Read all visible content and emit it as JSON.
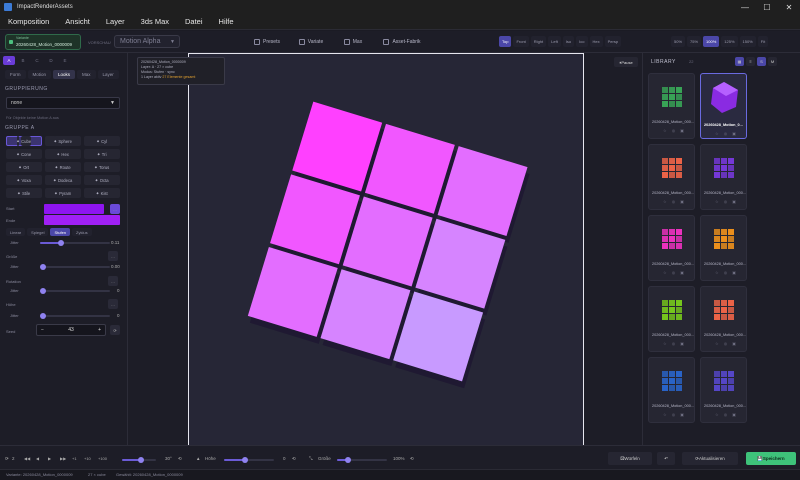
{
  "window": {
    "title": "ImpactRenderAssets",
    "min": "—",
    "max": "☐",
    "close": "✕"
  },
  "menu": [
    "Komposition",
    "Ansicht",
    "Layer",
    "3ds Max",
    "Datei",
    "Hilfe"
  ],
  "toolbar": {
    "variant_caption": "Variante",
    "variant_name": "20260428_Motion_0000009",
    "vorschau_label": "VORSCHAU",
    "preset_dropdown": "Motion Alpha",
    "center_buttons": [
      "Presets",
      "Variate",
      "Max",
      "Asset-Fabrik"
    ],
    "view_buttons": [
      "Top",
      "Front",
      "Right",
      "Left",
      "Iso",
      "Ico",
      "Hex",
      "Persp"
    ],
    "active_view": "Top",
    "zoom_buttons": [
      "50%",
      "75%",
      "100%",
      "125%",
      "150%",
      "Fit"
    ],
    "active_zoom": "100%"
  },
  "sidebar": {
    "layer_tabs": [
      "A",
      "B",
      "C",
      "D",
      "E"
    ],
    "active_layer": "A",
    "tabs": [
      "Form",
      "Motion",
      "Looks",
      "Max",
      "Layer"
    ],
    "active_tab": "Looks",
    "gruppierung_label": "GRUPPIERUNG",
    "gruppierung_value": "none",
    "hint": "Für Objekte keine Motion A aus",
    "gruppe_label": "GRUPPE A",
    "shapes": [
      "Cube",
      "Sphere",
      "Cyl",
      "Cone",
      "Hex",
      "Tri",
      "Ort",
      "Route",
      "Torus",
      "Voxa",
      "Dodeca",
      "Octa",
      "Stile",
      "Pyram",
      "Kist"
    ],
    "active_shape": "Cube",
    "start_label": "Start",
    "ende_label": "Ende",
    "color_start": "#8e15f0",
    "color_ende": "#a020f5",
    "mode_tabs": [
      "Linear",
      "Spiegel",
      "Stufen",
      "Zyklus"
    ],
    "active_mode": "Stufen",
    "rows": [
      {
        "label": "Jitter",
        "value": "0.11",
        "fraction": 0.3
      },
      {
        "label": "Größe",
        "sub": "Jitter",
        "value": "0.00",
        "fraction": 0.0
      },
      {
        "label": "Rotation",
        "sub": "Jitter",
        "value": "0",
        "fraction": 0.0
      },
      {
        "label": "Höhe",
        "sub": "Jitter",
        "value": "0",
        "fraction": 0.0
      }
    ],
    "seed_label": "Seed",
    "seed_value": "43",
    "seed_minus": "−",
    "seed_plus": "+"
  },
  "viewport": {
    "info_line1": "20260428_Motion_0000009",
    "info_line2": "Layer: A  ·  27 × cube",
    "info_line3": "Modus: Stufen  ·  sync",
    "info_line4a": "1 Layer aktiv",
    "info_line4b": "27 Elemente gesamt",
    "pause_label": "Pause",
    "cube_color_top": "#ff4fff",
    "cube_color_bottom": "#c080ff"
  },
  "library": {
    "title": "LIBRARY",
    "count": "22",
    "tiles": [
      {
        "name": "20260428_Motion_000...",
        "color": "#3ab05a"
      },
      {
        "name": "20260428_Motion_0...",
        "color": "#8a2be2",
        "selected": true
      },
      {
        "name": "20260428_Motion_000...",
        "color": "#ff6a4a"
      },
      {
        "name": "20260428_Motion_000...",
        "color": "#7d3ae8"
      },
      {
        "name": "20260428_Motion_000...",
        "color": "#ff33cc"
      },
      {
        "name": "20260428_Motion_000...",
        "color": "#ff9a1a"
      },
      {
        "name": "20260428_Motion_000...",
        "color": "#7dd61a"
      },
      {
        "name": "20260428_Motion_000...",
        "color": "#ff6a4a"
      },
      {
        "name": "20260428_Motion_000...",
        "color": "#2a6ad6"
      },
      {
        "name": "20260428_Motion_000...",
        "color": "#5a4ad6"
      }
    ]
  },
  "bottombar": {
    "frame": "2",
    "nav": [
      "◀◀",
      "◀",
      "▶",
      "▶▶",
      "+1",
      "+10",
      "+100"
    ],
    "rot_label": "Rotation",
    "rot_value": "30°",
    "hoehe_label": "Höhe",
    "hoehe_value": "0",
    "groesse_label": "Größe",
    "groesse_value": "100%",
    "wuerfeln": "Würfeln",
    "aktualisieren": "Aktualisieren",
    "speichern": "Speichern"
  },
  "status": {
    "variant": "Variante: 20260428_Motion_0000009",
    "count": "27 × cube",
    "selected": "Gewählt: 20260428_Motion_0000009"
  }
}
